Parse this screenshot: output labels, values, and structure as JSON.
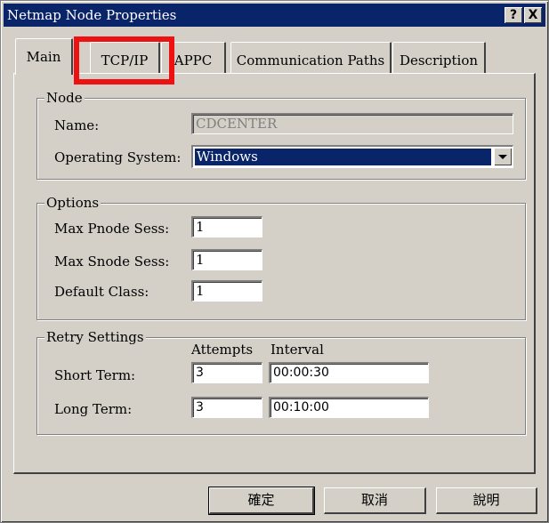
{
  "window": {
    "title": "Netmap Node Properties",
    "help_button": "?",
    "close_button": "X"
  },
  "tabs": [
    {
      "label": "Main",
      "active": true
    },
    {
      "label": "TCP/IP",
      "highlighted": true
    },
    {
      "label": "APPC"
    },
    {
      "label": "Communication Paths"
    },
    {
      "label": "Description"
    }
  ],
  "node_group": {
    "legend": "Node",
    "name_label": "Name:",
    "name_value": "CDCENTER",
    "os_label": "Operating System:",
    "os_value": "Windows"
  },
  "options_group": {
    "legend": "Options",
    "max_pnode_label": "Max Pnode Sess:",
    "max_pnode_value": "1",
    "max_snode_label": "Max Snode Sess:",
    "max_snode_value": "1",
    "default_class_label": "Default Class:",
    "default_class_value": "1"
  },
  "retry_group": {
    "legend": "Retry Settings",
    "attempts_header": "Attempts",
    "interval_header": "Interval",
    "short_term_label": "Short Term:",
    "short_term_attempts": "3",
    "short_term_interval": "00:00:30",
    "long_term_label": "Long Term:",
    "long_term_attempts": "3",
    "long_term_interval": "00:10:00"
  },
  "buttons": {
    "ok": "確定",
    "cancel": "取消",
    "help": "說明"
  },
  "colors": {
    "highlight": "#ee1111",
    "titlebar": "#0a246a",
    "face": "#d4d0c8"
  }
}
